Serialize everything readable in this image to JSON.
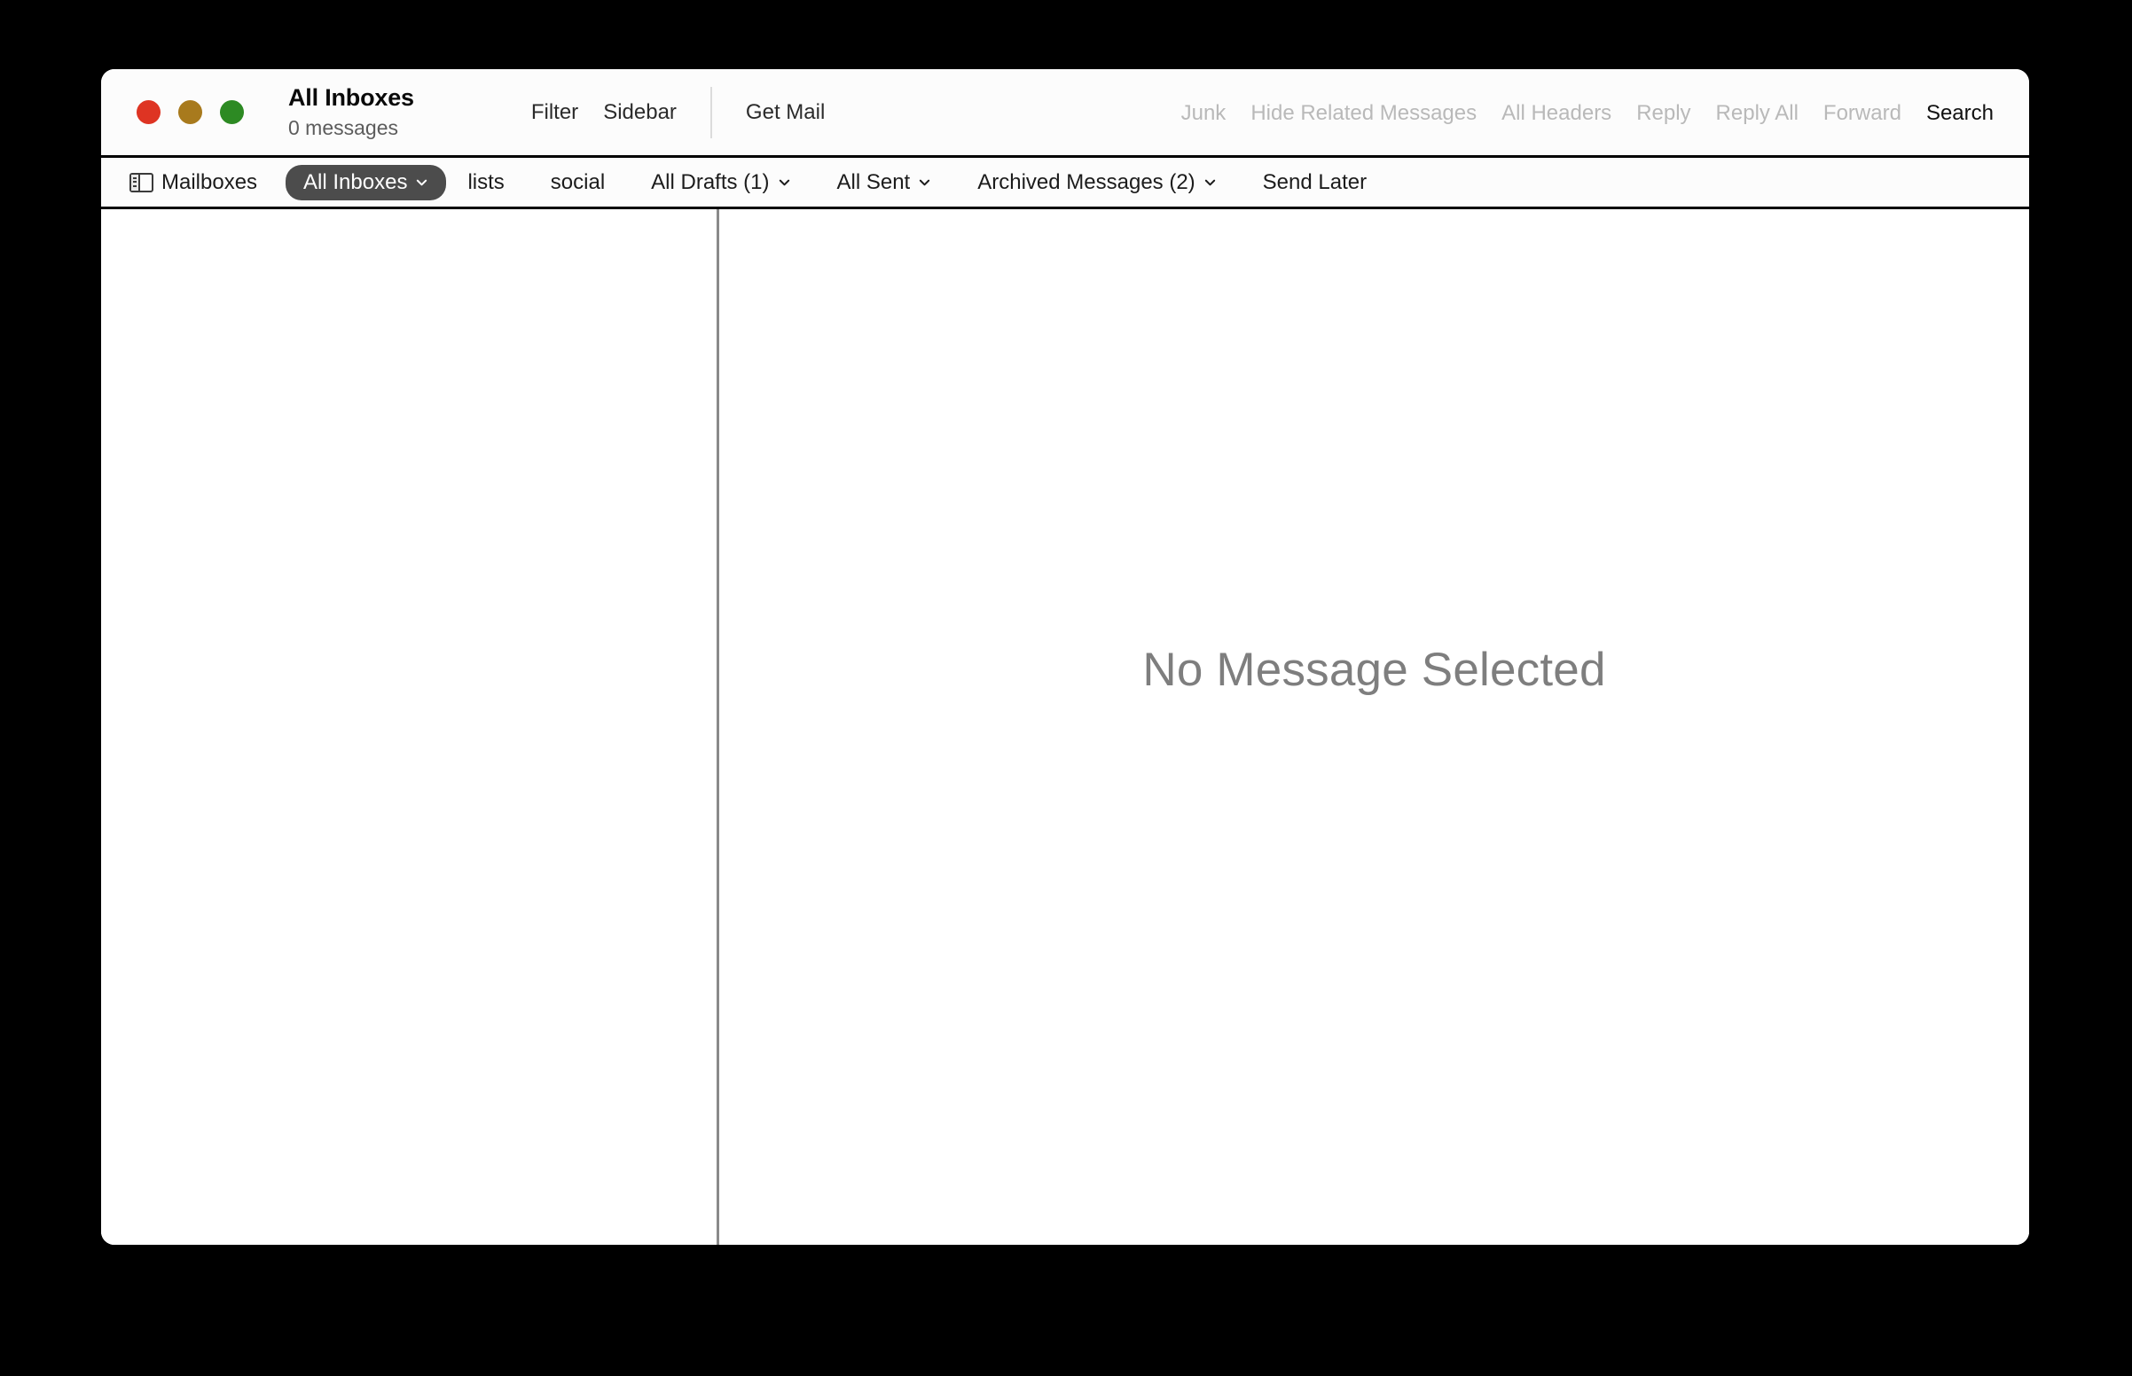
{
  "window": {
    "title": "All Inboxes",
    "subtitle": "0 messages",
    "traffic_lights": [
      {
        "name": "close",
        "color": "#de3423"
      },
      {
        "name": "minimize",
        "color": "#a87a1d"
      },
      {
        "name": "zoom",
        "color": "#2d8a23"
      }
    ]
  },
  "toolbar": {
    "center": [
      {
        "label": "Filter",
        "state": "enabled"
      },
      {
        "label": "Sidebar",
        "state": "enabled"
      },
      {
        "label": "Get Mail",
        "state": "enabled"
      }
    ],
    "filter_label": "Filter",
    "sidebar_label": "Sidebar",
    "get_mail_label": "Get Mail",
    "right": [
      {
        "label": "Junk",
        "state": "disabled"
      },
      {
        "label": "Hide Related Messages",
        "state": "disabled"
      },
      {
        "label": "All Headers",
        "state": "disabled"
      },
      {
        "label": "Reply",
        "state": "disabled"
      },
      {
        "label": "Reply All",
        "state": "disabled"
      },
      {
        "label": "Forward",
        "state": "disabled"
      },
      {
        "label": "Search",
        "state": "enabled"
      }
    ],
    "junk_label": "Junk",
    "hide_related_label": "Hide Related Messages",
    "all_headers_label": "All Headers",
    "reply_label": "Reply",
    "reply_all_label": "Reply All",
    "forward_label": "Forward",
    "search_label": "Search"
  },
  "favorites_bar": {
    "mailboxes_label": "Mailboxes",
    "items": [
      {
        "label": "All Inboxes",
        "selected": true,
        "has_chevron": true
      },
      {
        "label": "lists",
        "selected": false,
        "has_chevron": false
      },
      {
        "label": "social",
        "selected": false,
        "has_chevron": false
      },
      {
        "label": "All Drafts (1)",
        "selected": false,
        "has_chevron": true
      },
      {
        "label": "All Sent",
        "selected": false,
        "has_chevron": true
      },
      {
        "label": "Archived Messages (2)",
        "selected": false,
        "has_chevron": true
      },
      {
        "label": "Send Later",
        "selected": false,
        "has_chevron": false
      }
    ],
    "all_inboxes_label": "All Inboxes",
    "lists_label": "lists",
    "social_label": "social",
    "all_drafts_label": "All Drafts (1)",
    "all_sent_label": "All Sent",
    "archived_label": "Archived Messages (2)",
    "send_later_label": "Send Later",
    "selected_color": "#4c4c4c"
  },
  "message_list": {
    "messages": [],
    "empty": true
  },
  "message_view": {
    "placeholder": "No Message Selected"
  },
  "colors": {
    "window_background": "#ffffff",
    "chrome_background": "#fcfcfc",
    "desktop_background": "#000000",
    "disabled_text": "#b9b9b9",
    "secondary_text": "#5c5c5c",
    "placeholder_text": "#7e7e7e"
  }
}
